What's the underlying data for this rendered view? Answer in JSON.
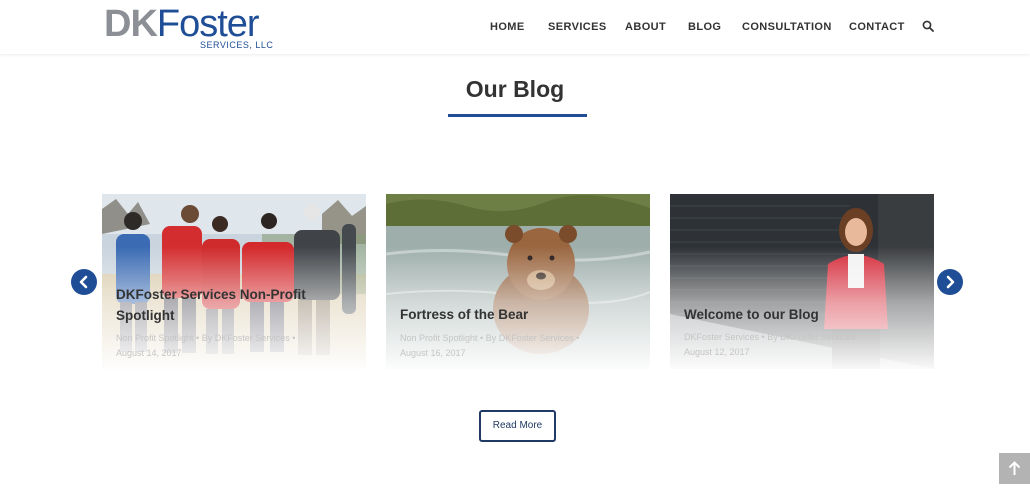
{
  "brand": {
    "logo_dk": "DK",
    "logo_foster": "Foster",
    "logo_sub": "SERVICES, LLC"
  },
  "nav": {
    "items": [
      {
        "label": "HOME"
      },
      {
        "label": "SERVICES"
      },
      {
        "label": "ABOUT"
      },
      {
        "label": "BLOG"
      },
      {
        "label": "CONSULTATION"
      },
      {
        "label": "CONTACT"
      }
    ],
    "search_icon": "search-icon"
  },
  "section": {
    "title": "Our Blog"
  },
  "posts": [
    {
      "title": "DKFoster Services Non-Profit Spotlight",
      "category": "Non Profit Spotlight",
      "author": "By DKFoster Services",
      "date": "August 14, 2017",
      "image": "people-arm-in-arm"
    },
    {
      "title": "Fortress of the Bear",
      "category": "Non Profit Spotlight",
      "author": "By DKFoster Services",
      "date": "August 16, 2017",
      "image": "brown-bear-in-water"
    },
    {
      "title": "Welcome to our Blog",
      "category": "DKFoster Services",
      "author": "By DKFoster Services",
      "date": "August 12, 2017",
      "image": "woman-in-red-blazer"
    }
  ],
  "carousel": {
    "prev_icon": "chevron-left-icon",
    "next_icon": "chevron-right-icon"
  },
  "actions": {
    "read_more": "Read More",
    "back_to_top_icon": "arrow-up-icon"
  },
  "colors": {
    "brand_blue": "#1f4e96",
    "brand_gray": "#8c9096",
    "button_border": "#1f3a64"
  }
}
